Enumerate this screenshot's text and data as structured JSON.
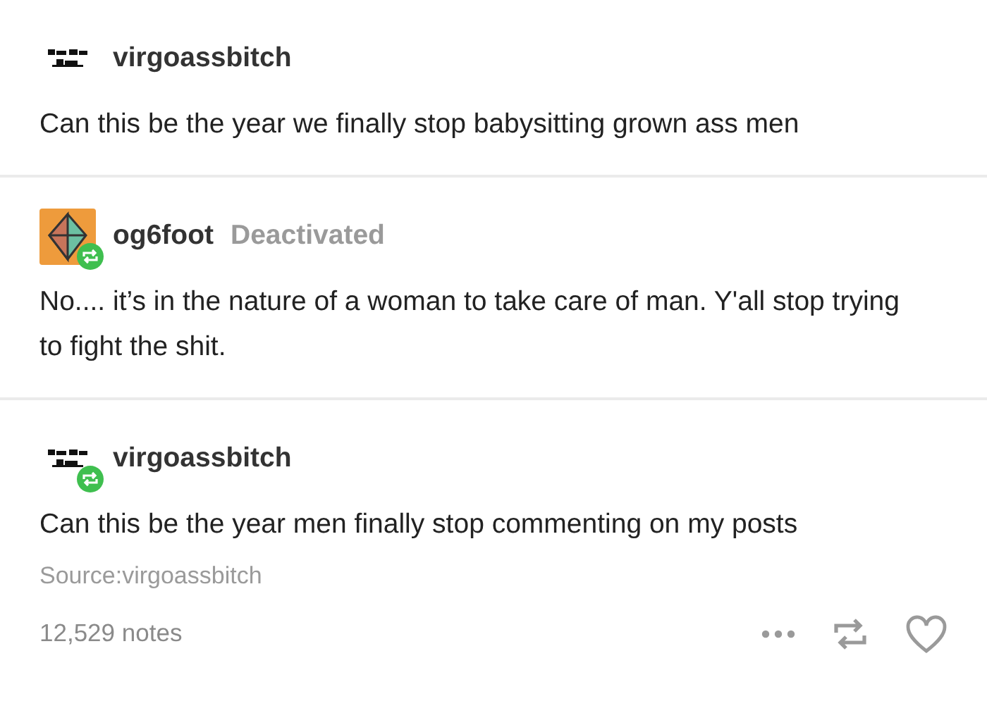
{
  "posts": [
    {
      "username": "virgoassbitch",
      "kind": "text-logo",
      "reblogged": false,
      "body": "Can this be the year we finally stop babysitting grown ass men"
    },
    {
      "username": "og6foot",
      "status": "Deactivated",
      "kind": "octahedron",
      "reblogged": true,
      "body": "No.... it’s in the nature of a woman to take care of man. Y'all stop trying to fight the shit."
    },
    {
      "username": "virgoassbitch",
      "kind": "text-logo",
      "reblogged": true,
      "body": "Can this be the year men finally stop commenting on my posts"
    }
  ],
  "source": "Source:virgoassbitch",
  "notes": "12,529 notes"
}
